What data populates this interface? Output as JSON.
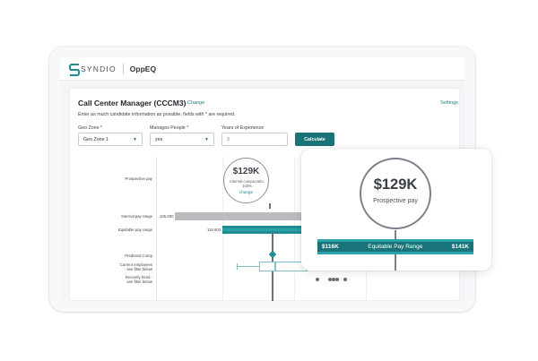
{
  "app": {
    "brand": "SYNDIO",
    "product": "OppEQ"
  },
  "page": {
    "title": "Call Center Manager (CCCM3)",
    "change_label": "Change",
    "settings_label": "Settings",
    "instructions": "Enter as much candidate information as possible; fields with * are required."
  },
  "form": {
    "geo_zone": {
      "label": "Geo Zone *",
      "value": "Geo Zone 1"
    },
    "manages_people": {
      "label": "Manages People *",
      "value": "yes"
    },
    "years_experience": {
      "label": "Years of Experience",
      "value": "3"
    },
    "calculate_label": "Calculate"
  },
  "chart": {
    "rows": {
      "prospective": "Prospective pay",
      "internal": "Internal pay range",
      "equitable": "Equitable pay range",
      "predicted": "Predicted Comp",
      "current_line1": "Current employees",
      "current_line2": "- see filter below",
      "recently_line1": "Recently hired -",
      "recently_line2": "see filter below"
    },
    "internal_min": "105,000",
    "equitable_min": "116,603",
    "prospective_value": "$129K",
    "compa_line1": "Internal compa-ratio:",
    "compa_line2": "103%",
    "change_link": "change"
  },
  "zoom": {
    "value": "$129K",
    "label": "Prospective pay",
    "range_min": "$116K",
    "range_label": "Equitable Pay Range",
    "range_max": "$141K"
  },
  "colors": {
    "accent": "#1a7378",
    "accent_light": "#2aa3a8",
    "gray_bar": "#b9bbbf"
  }
}
